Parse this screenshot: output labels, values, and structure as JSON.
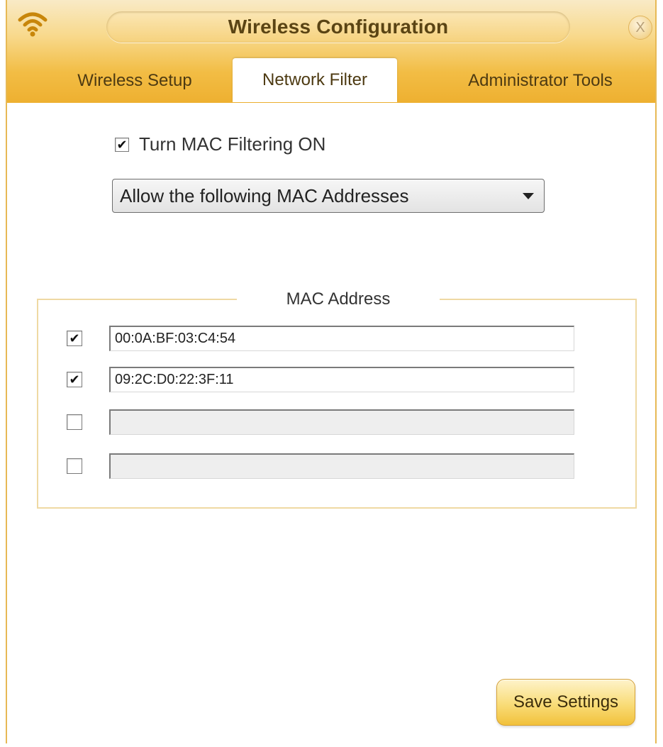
{
  "window": {
    "title": "Wireless Configuration",
    "close_glyph": "X"
  },
  "tabs": [
    {
      "label": "Wireless Setup",
      "active": false
    },
    {
      "label": "Network Filter",
      "active": true
    },
    {
      "label": "Administrator Tools",
      "active": false
    }
  ],
  "mac_filter": {
    "toggle_label": "Turn MAC Filtering ON",
    "toggle_checked": true,
    "mode_selected": "Allow the following MAC Addresses"
  },
  "mac_table": {
    "legend": "MAC Address",
    "rows": [
      {
        "checked": true,
        "value": "00:0A:BF:03:C4:54",
        "enabled": true
      },
      {
        "checked": true,
        "value": "09:2C:D0:22:3F:11",
        "enabled": true
      },
      {
        "checked": false,
        "value": "",
        "enabled": false
      },
      {
        "checked": false,
        "value": "",
        "enabled": false
      }
    ]
  },
  "actions": {
    "save_label": "Save Settings"
  },
  "colors": {
    "accent": "#f2bd45",
    "accent_dark": "#e7b955",
    "text": "#333333"
  },
  "icons": {
    "app": "wifi-icon",
    "close": "close-icon",
    "dropdown": "chevron-down-icon",
    "check": "checkmark-icon"
  }
}
